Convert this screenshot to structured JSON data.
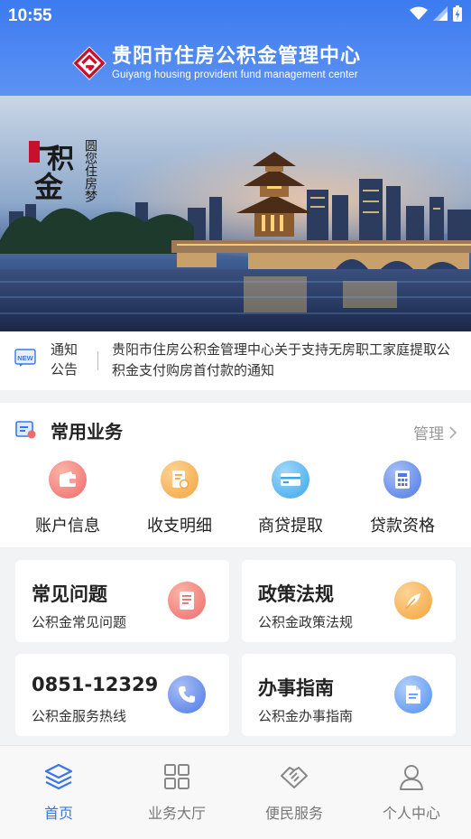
{
  "status_bar": {
    "time": "10:55"
  },
  "header": {
    "title_cn": "贵阳市住房公积金管理中心",
    "title_en": "Guiyang housing provident fund management center"
  },
  "banner": {
    "brand_glyphs": "一积金",
    "slogan": "圆您住房梦",
    "seal": "贵阳"
  },
  "notice": {
    "badge": "NEW",
    "label": "通知公告",
    "text": "贵阳市住房公积金管理中心关于支持无房职工家庭提取公积金支付购房首付款的通知"
  },
  "common_services": {
    "title": "常用业务",
    "manage_label": "管理",
    "items": [
      {
        "label": "账户信息",
        "icon": "wallet-icon",
        "color": "#ef6b6b"
      },
      {
        "label": "收支明细",
        "icon": "receipt-icon",
        "color": "#f4a33a"
      },
      {
        "label": "商贷提取",
        "icon": "card-icon",
        "color": "#39a6ec"
      },
      {
        "label": "贷款资格",
        "icon": "calculator-icon",
        "color": "#4d78e6"
      }
    ]
  },
  "cards": [
    {
      "title": "常见问题",
      "subtitle": "公积金常见问题",
      "icon": "document-icon",
      "color": "#ef6b6b"
    },
    {
      "title": "政策法规",
      "subtitle": "公积金政策法规",
      "icon": "feather-icon",
      "color": "#f4a33a"
    },
    {
      "title": "0851-12329",
      "subtitle": "公积金服务热线",
      "icon": "phone-icon",
      "color": "#4d78e6"
    },
    {
      "title": "办事指南",
      "subtitle": "公积金办事指南",
      "icon": "file-icon",
      "color": "#4d8ff0"
    }
  ],
  "tabbar": {
    "items": [
      {
        "label": "首页",
        "icon": "home-layers-icon",
        "active": true
      },
      {
        "label": "业务大厅",
        "icon": "grid-icon",
        "active": false
      },
      {
        "label": "便民服务",
        "icon": "handshake-icon",
        "active": false
      },
      {
        "label": "个人中心",
        "icon": "person-icon",
        "active": false
      }
    ]
  },
  "colors": {
    "primary": "#3a76e8",
    "header_top": "#3c7bf0",
    "logo_red": "#c8102e"
  }
}
